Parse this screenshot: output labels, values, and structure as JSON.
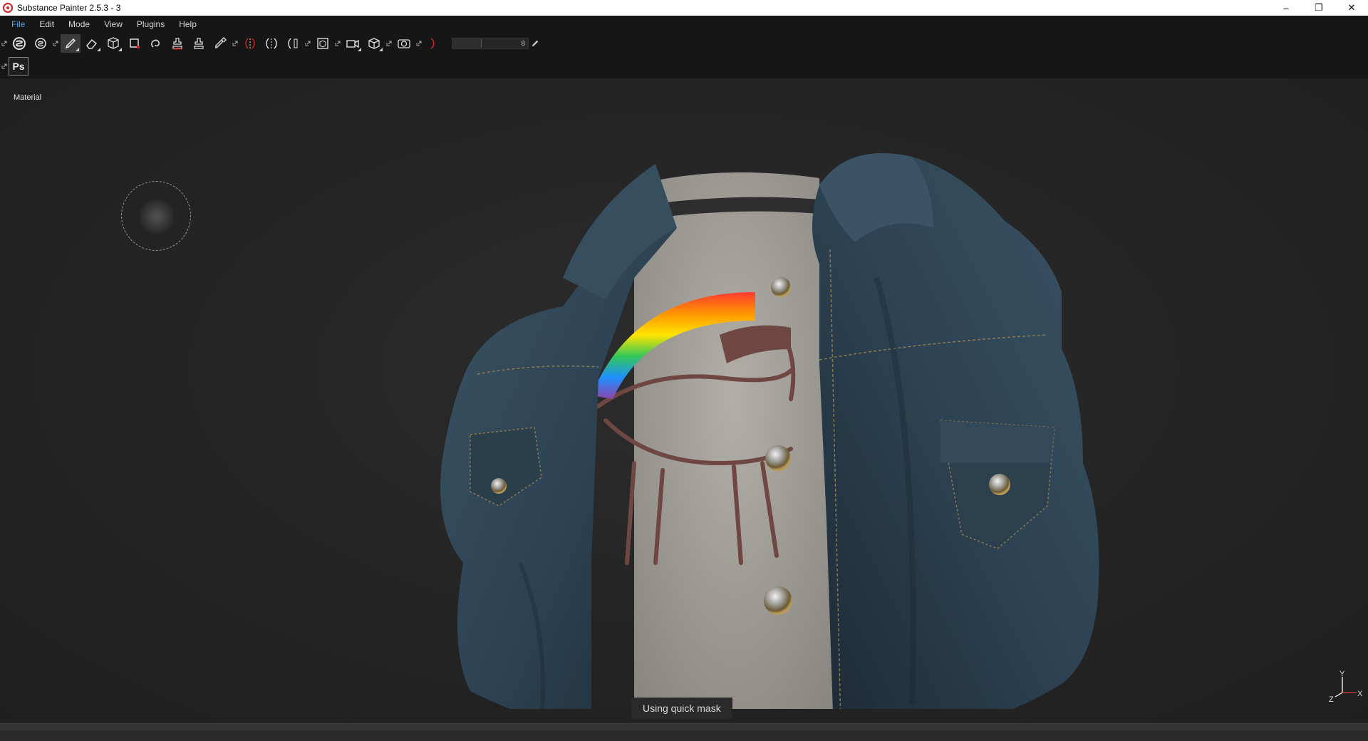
{
  "window": {
    "title": "Substance Painter 2.5.3 - 3",
    "minimize": "–",
    "restore": "❐",
    "close": "✕"
  },
  "menu": {
    "items": [
      "File",
      "Edit",
      "Mode",
      "View",
      "Plugins",
      "Help"
    ],
    "active": "File"
  },
  "toolbar": {
    "brush_size_value": "8",
    "photoshop_label": "Ps"
  },
  "viewport": {
    "mode_label": "Material",
    "status_message": "Using quick mask",
    "gizmo": {
      "y": "Y",
      "z": "Z",
      "x": "X"
    }
  },
  "colors": {
    "accent": "#3aa9ff",
    "app_icon": "#d21f1f",
    "denim": "#2e4250",
    "shirt": "#a3a09a",
    "print": "#6e4642"
  }
}
